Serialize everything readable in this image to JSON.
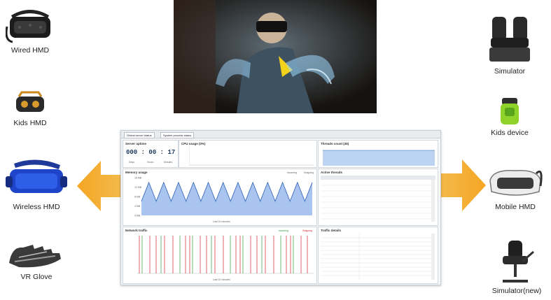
{
  "devices": {
    "wired_hmd": "Wired HMD",
    "kids_hmd": "Kids HMD",
    "wireless_hmd": "Wireless HMD",
    "vr_glove": "VR Glove",
    "simulator": "Simulator",
    "kids_device": "Kids device",
    "mobile_hmd": "Mobile HMD",
    "simulator_new": "Simulator(new)"
  },
  "dashboard": {
    "tabs": [
      "Global server status",
      "System process status"
    ],
    "server_uptime": {
      "title": "Server uptime",
      "days": "000",
      "hours": "00",
      "minutes": "17",
      "sep": ":",
      "labels": [
        "Days",
        "Hours",
        "Minutes"
      ]
    },
    "cpu_title": "CPU usage (0%)",
    "threads_title": "Threads count (45)",
    "memory_title": "Memory usage",
    "active_threads_title": "Active threads",
    "network_title": "Network traffic",
    "traffic_details_title": "Traffic details",
    "legend_incoming": "Incoming",
    "legend_outgoing": "Outgoing",
    "last_minutes": "Last 10 minutes",
    "colors": {
      "memory_line": "#2c5fb8",
      "memory_fill": "#a9c4ee",
      "incoming": "#2e9e3e",
      "outgoing": "#d2262b"
    }
  },
  "chart_data": {
    "type": "line",
    "title": "Memory usage",
    "xlabel": "Last 10 minutes",
    "yticks": [
      "16 MB",
      "12 MB",
      "8 MB",
      "4 MB",
      "0 MB"
    ],
    "series": [
      {
        "values": [
          6,
          14,
          6,
          14,
          6,
          14,
          6,
          14,
          6,
          14,
          6,
          14,
          6,
          14,
          6,
          14,
          6,
          14,
          6,
          14,
          6,
          14,
          6,
          14
        ]
      }
    ]
  }
}
